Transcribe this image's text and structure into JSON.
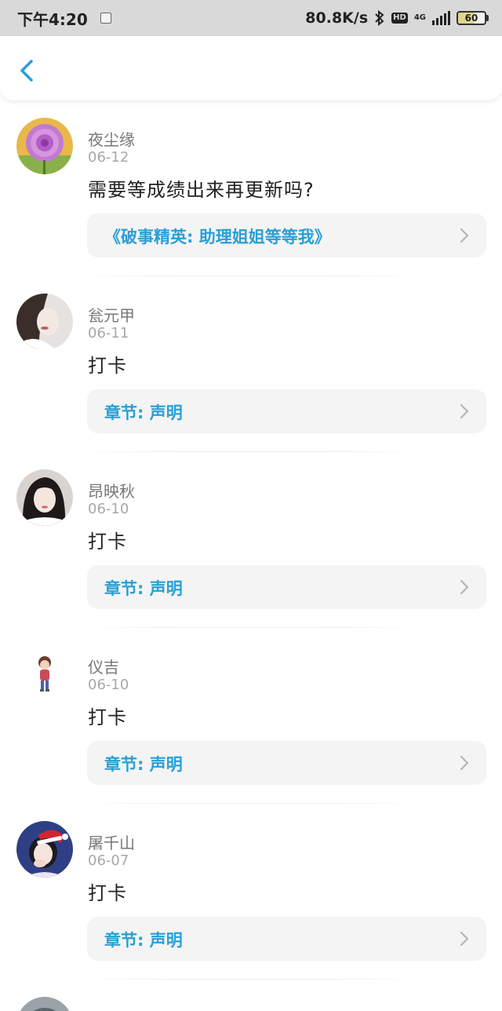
{
  "status_bar": {
    "time": "下午4:20",
    "speed": "80.8K/s",
    "network": "4G",
    "battery": "60"
  },
  "colors": {
    "link": "#2a9fd6",
    "back": "#2a9fd6",
    "card_bg": "#f4f4f4"
  },
  "comments": [
    {
      "user": "夜尘缘",
      "date": "06-12",
      "text": "需要等成绩出来再更新吗?",
      "link": "《破事精英: 助理姐姐等等我》",
      "avatar": "purple-flower"
    },
    {
      "user": "瓮元甲",
      "date": "06-11",
      "text": "打卡",
      "link": "章节: 声明",
      "avatar": "girl-gray"
    },
    {
      "user": "昂映秋",
      "date": "06-10",
      "text": "打卡",
      "link": "章节: 声明",
      "avatar": "girl-dark"
    },
    {
      "user": "仪吉",
      "date": "06-10",
      "text": "打卡",
      "link": "章节: 声明",
      "avatar": "cartoon-boy"
    },
    {
      "user": "屠千山",
      "date": "06-07",
      "text": "打卡",
      "link": "章节: 声明",
      "avatar": "santa-hat-girl"
    }
  ]
}
